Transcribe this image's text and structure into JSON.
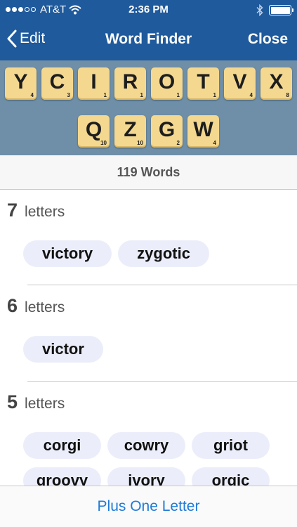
{
  "status_bar": {
    "carrier": "AT&T",
    "time": "2:36 PM",
    "signal_bars_filled": 3,
    "signal_bars_total": 5,
    "battery_level": 1.0
  },
  "nav": {
    "back_label": "Edit",
    "title": "Word Finder",
    "close_label": "Close"
  },
  "tiles": {
    "row1": [
      {
        "letter": "Y",
        "value": "4"
      },
      {
        "letter": "C",
        "value": "3"
      },
      {
        "letter": "I",
        "value": "1"
      },
      {
        "letter": "R",
        "value": "1"
      },
      {
        "letter": "O",
        "value": "1"
      },
      {
        "letter": "T",
        "value": "1"
      },
      {
        "letter": "V",
        "value": "4"
      },
      {
        "letter": "X",
        "value": "8"
      }
    ],
    "row2": [
      {
        "letter": "Q",
        "value": "10"
      },
      {
        "letter": "Z",
        "value": "10"
      },
      {
        "letter": "G",
        "value": "2"
      },
      {
        "letter": "W",
        "value": "4"
      }
    ]
  },
  "word_count": "119 Words",
  "sections": [
    {
      "num": "7",
      "label": "letters",
      "words": [
        "victory",
        "zygotic"
      ]
    },
    {
      "num": "6",
      "label": "letters",
      "words": [
        "victor"
      ]
    },
    {
      "num": "5",
      "label": "letters",
      "words": [
        "corgi",
        "cowry",
        "griot",
        "groovy",
        "ivory",
        "orgic"
      ]
    }
  ],
  "toolbar": {
    "action_label": "Plus One Letter"
  },
  "colors": {
    "nav_background": "#1f5a9c",
    "tray_background": "#6f8fa8",
    "tile": "#f4d88f",
    "chip": "#ebeefa",
    "link": "#1e7bd8"
  }
}
